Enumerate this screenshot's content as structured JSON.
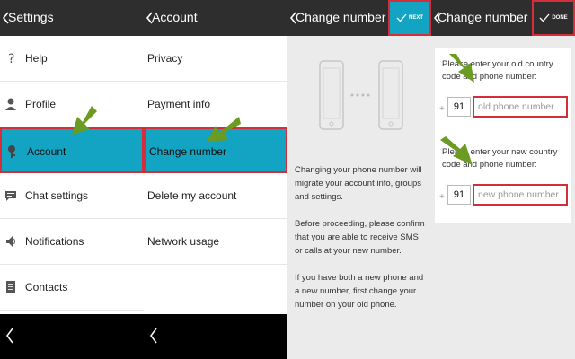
{
  "colors": {
    "accent": "#12a4c2",
    "highlight_border": "#d32f3b",
    "actionbar": "#2e2e2e",
    "arrow": "#6b9b22"
  },
  "settings_panel": {
    "title": "Settings",
    "items": [
      {
        "label": "Help",
        "icon": "help-icon"
      },
      {
        "label": "Profile",
        "icon": "profile-icon"
      },
      {
        "label": "Account",
        "icon": "key-icon",
        "selected": true
      },
      {
        "label": "Chat settings",
        "icon": "chat-icon"
      },
      {
        "label": "Notifications",
        "icon": "speaker-icon"
      },
      {
        "label": "Contacts",
        "icon": "contacts-icon"
      }
    ]
  },
  "account_panel": {
    "title": "Account",
    "items": [
      {
        "label": "Privacy"
      },
      {
        "label": "Payment info"
      },
      {
        "label": "Change number",
        "selected": true
      },
      {
        "label": "Delete my account"
      },
      {
        "label": "Network usage"
      }
    ]
  },
  "change_number_intro": {
    "title": "Change number",
    "next_label": "NEXT",
    "paragraphs": [
      "Changing your phone number will migrate your account info, groups and settings.",
      "Before proceeding, please confirm that you are able to receive SMS or calls at your new number.",
      "If you have both a new phone and a new number, first change your number on your old phone."
    ]
  },
  "change_number_form": {
    "title": "Change number",
    "done_label": "DONE",
    "old_label": "Please enter your old country code and phone number:",
    "new_label": "Please enter your new country code and phone number:",
    "plus": "+",
    "old_code": "91",
    "old_placeholder": "old phone number",
    "new_code": "91",
    "new_placeholder": "new phone number"
  }
}
